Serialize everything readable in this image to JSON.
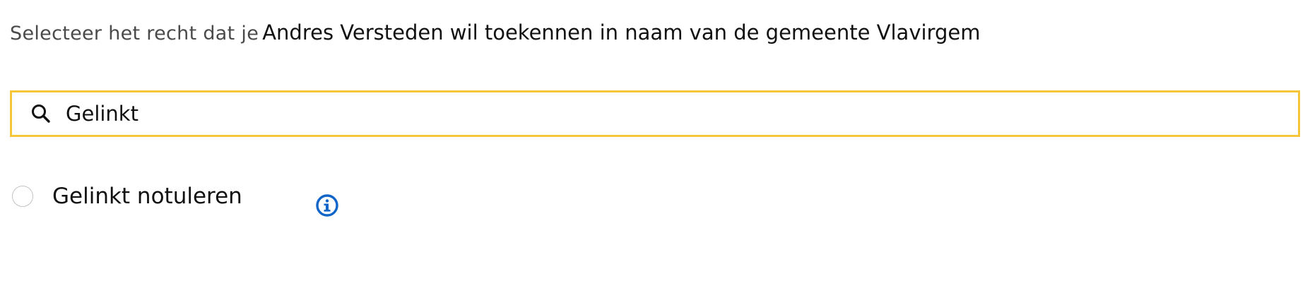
{
  "intro": {
    "prefix": "Selecteer het recht dat je",
    "main": "Andres Versteden wil toekennen in naam van de gemeente Vlavirgem"
  },
  "search": {
    "value": "Gelinkt",
    "icon": "search-icon",
    "focus_color": "#f5c63a"
  },
  "options": [
    {
      "label": "Gelinkt notuleren",
      "selected": false,
      "info_icon": "info-icon"
    }
  ],
  "colors": {
    "info_icon": "#0f65c8"
  }
}
